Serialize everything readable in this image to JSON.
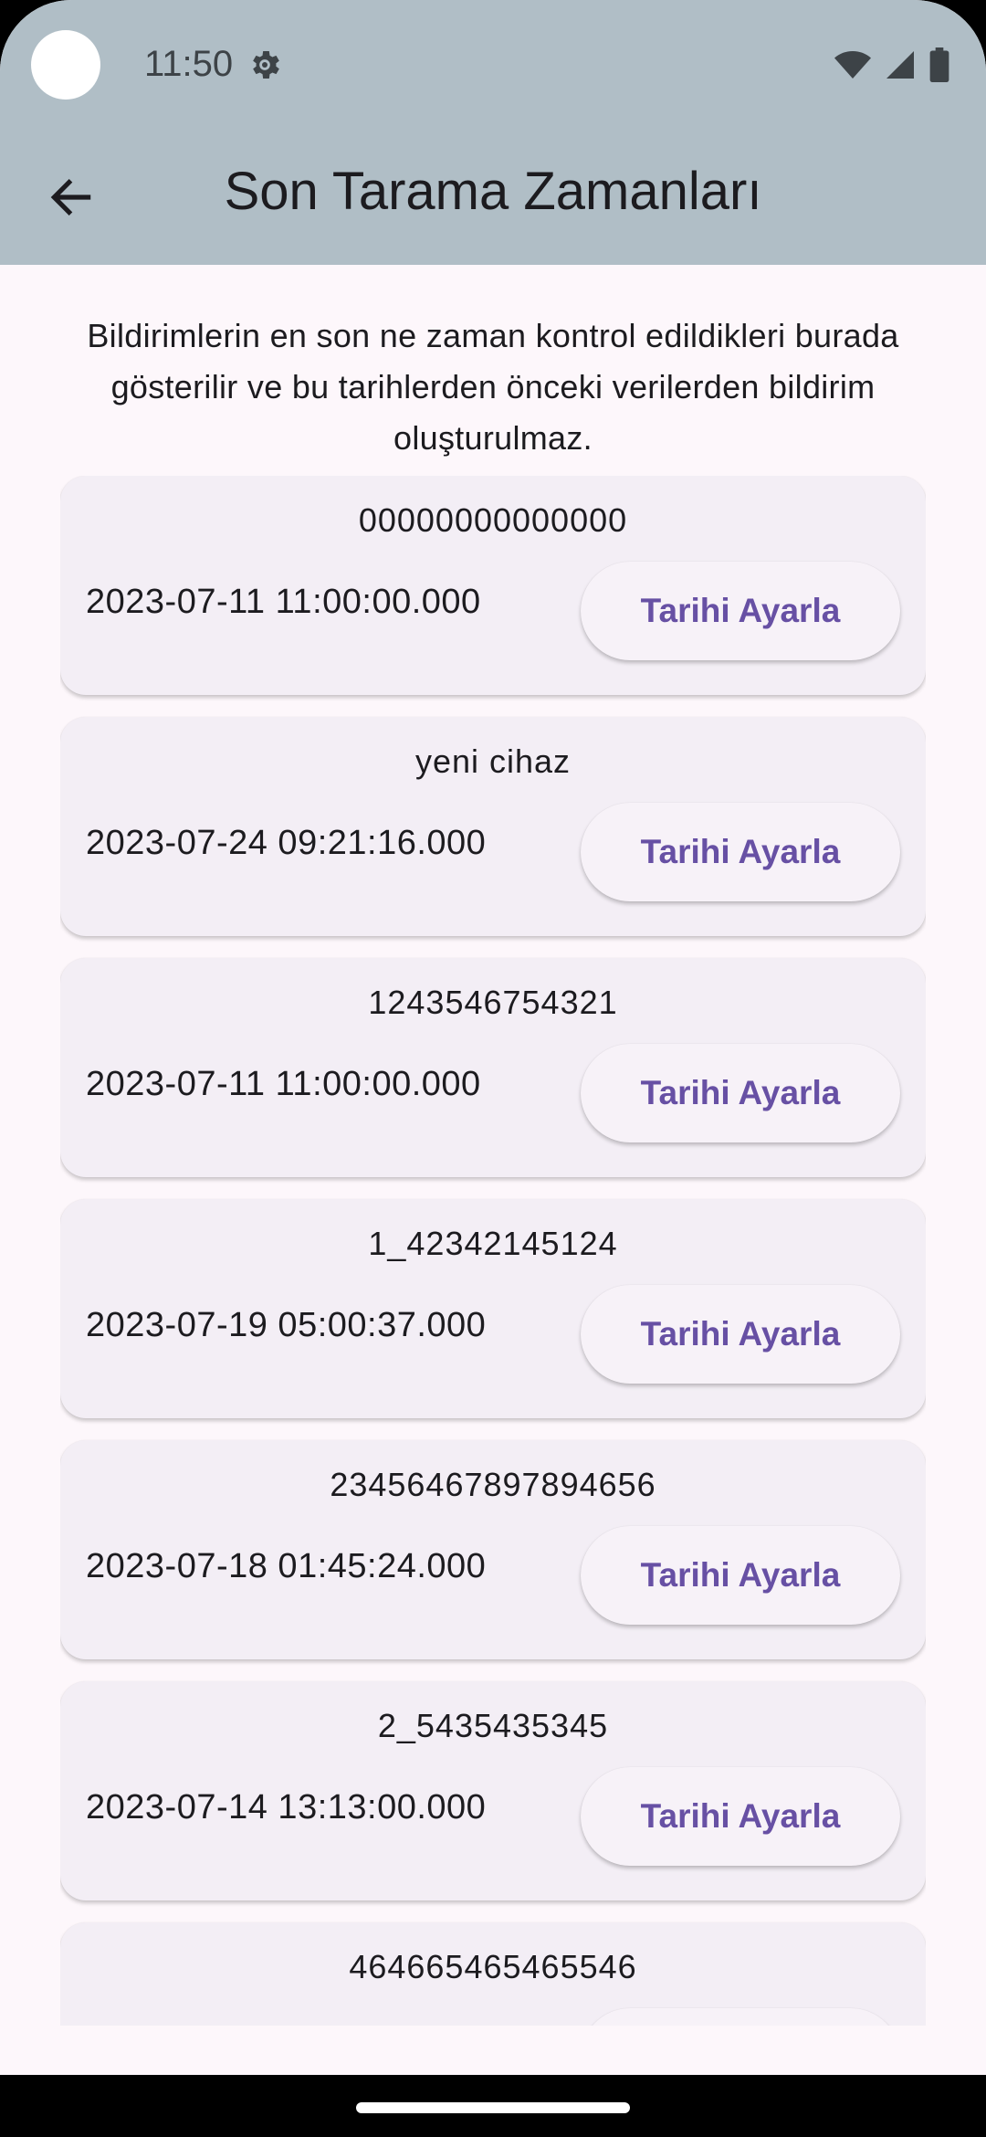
{
  "status_bar": {
    "time": "11:50",
    "icons": [
      "settings-gear-icon",
      "wifi-icon",
      "cellular-signal-icon",
      "battery-icon"
    ]
  },
  "app_bar": {
    "title": "Son Tarama Zamanları",
    "back_icon": "arrow-back-icon"
  },
  "description": "Bildirimlerin en son ne zaman kontrol edildikleri burada gösterilir ve bu tarihlerden önceki verilerden bildirim oluşturulmaz.",
  "devices": [
    {
      "id": "00000000000000",
      "date": "2023-07-11 11:00:00.000",
      "button": "Tarihi Ayarla"
    },
    {
      "id": "yeni cihaz",
      "date": "2023-07-24 09:21:16.000",
      "button": "Tarihi Ayarla"
    },
    {
      "id": "1243546754321",
      "date": "2023-07-11 11:00:00.000",
      "button": "Tarihi Ayarla"
    },
    {
      "id": "1_42342145124",
      "date": "2023-07-19 05:00:37.000",
      "button": "Tarihi Ayarla"
    },
    {
      "id": "23456467897894656",
      "date": "2023-07-18 01:45:24.000",
      "button": "Tarihi Ayarla"
    },
    {
      "id": "2_5435435345",
      "date": "2023-07-14 13:13:00.000",
      "button": "Tarihi Ayarla"
    },
    {
      "id": "464665465465546",
      "date": "",
      "button": ""
    }
  ],
  "colors": {
    "app_bar": "#b0bec6",
    "background": "#fdf7fb",
    "card": "#f3eef5",
    "accent": "#6750a4"
  }
}
